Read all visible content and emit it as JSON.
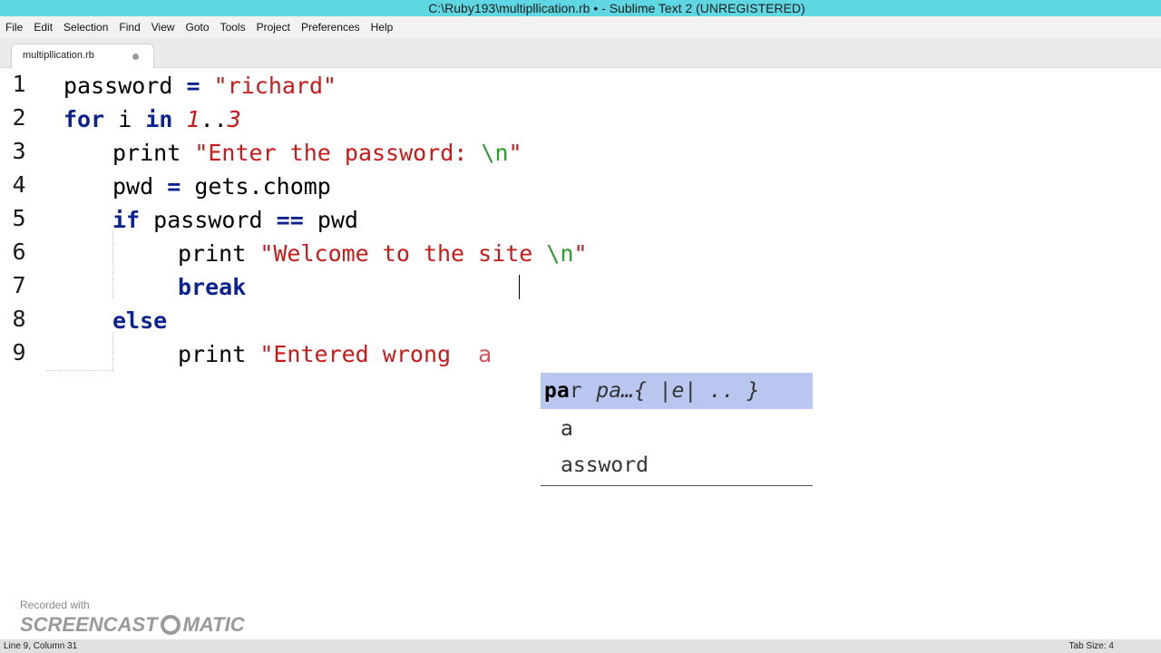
{
  "window": {
    "title": "C:\\Ruby193\\multipllication.rb • - Sublime Text 2 (UNREGISTERED)"
  },
  "menu": [
    "File",
    "Edit",
    "Selection",
    "Find",
    "View",
    "Goto",
    "Tools",
    "Project",
    "Preferences",
    "Help"
  ],
  "tab": {
    "label": "multipllication.rb",
    "modified": true
  },
  "gutter": [
    "1",
    "2",
    "3",
    "4",
    "5",
    "6",
    "7",
    "8",
    "9"
  ],
  "code": {
    "l1": {
      "a": "password",
      "op": "=",
      "s": "\"richard\""
    },
    "l2": {
      "kw1": "for",
      "var": "i",
      "kw2": "in",
      "n1": "1",
      "dots": "..",
      "n2": "3"
    },
    "l3": {
      "fn": "print",
      "s": "\"Enter the password: ",
      "esc": "\\n",
      "q": "\""
    },
    "l4": {
      "a": "pwd",
      "op": "=",
      "b": "gets.chomp"
    },
    "l5": {
      "kw": "if",
      "a": "password",
      "op": "==",
      "b": "pwd"
    },
    "l6": {
      "fn": "print",
      "s": "\"Welcome to the site ",
      "esc": "\\n",
      "q": "\""
    },
    "l7": {
      "kw": "break"
    },
    "l8": {
      "kw": "else"
    },
    "l9": {
      "fn": "print",
      "s": "\"Entered wrong ",
      "typed": "a"
    }
  },
  "autocomplete": {
    "items": [
      {
        "match": "pa",
        "rest": "r",
        "hint": "pa…{ |e| .. }"
      },
      {
        "match": "",
        "rest": "a",
        "hint": ""
      },
      {
        "match": "",
        "rest": "assword",
        "hint": ""
      }
    ]
  },
  "watermark": {
    "recorded": "Recorded with",
    "brand_left": "SCREENCAST",
    "brand_right": "MATIC"
  },
  "status": {
    "position": "Line 9, Column 31",
    "tab_size": "Tab Size: 4"
  },
  "colors": {
    "titlebar": "#5fd7e3",
    "keyword": "#0b2390",
    "string": "#c91a1a",
    "escape": "#2a9d2a",
    "ac_selected": "#b9c7f0"
  }
}
